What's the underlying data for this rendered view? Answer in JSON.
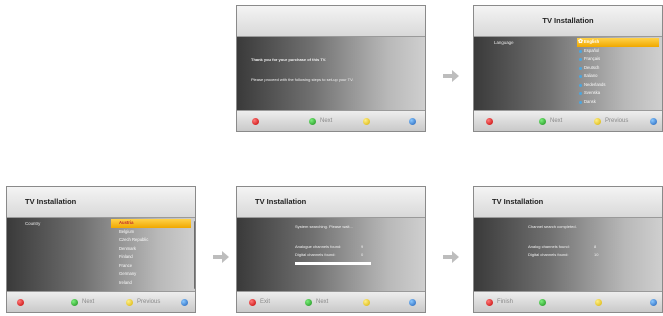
{
  "screen1": {
    "line1": "Thank you for your purchase of this TV.",
    "line2": "Please proceed with the following steps to set-up your TV.",
    "footer": {
      "next": "Next"
    }
  },
  "screen2": {
    "title": "TV Installation",
    "label": "Language",
    "options": [
      "English",
      "Español",
      "Français",
      "Deutsch",
      "Italiano",
      "Nederlands",
      "Svenska",
      "Dansk"
    ],
    "selected": "English",
    "footer": {
      "next": "Next",
      "previous": "Previous"
    }
  },
  "screen3": {
    "title": "TV Installation",
    "label": "Country",
    "options": [
      "Austria",
      "Belgium",
      "Czech Republic",
      "Denmark",
      "Finland",
      "France",
      "Germany",
      "Ireland"
    ],
    "selected": "Austria",
    "footer": {
      "next": "Next",
      "previous": "Previous"
    }
  },
  "screen4": {
    "title": "TV Installation",
    "status": "System searching.  Please wait...",
    "analogue_label": "Analogue channels found:",
    "analogue_value": "9",
    "digital_label": "Digital channels found:",
    "digital_value": "0",
    "progress": 1.0,
    "footer": {
      "exit": "Exit",
      "next": "Next"
    }
  },
  "screen5": {
    "title": "TV Installation",
    "status": "Channel search completed.",
    "analog_label": "Analog channels found:",
    "analog_value": "8",
    "digital_label": "Digital channels found:",
    "digital_value": "10",
    "footer": {
      "finish": "Finish"
    }
  },
  "colors": {
    "header_bg": "#e6e6e6",
    "highlight": "#f5b800",
    "button_red": "#c40000",
    "button_green": "#1a8c1a",
    "button_yellow": "#d8b000",
    "button_blue": "#1e5fb8",
    "arrow": "#bdbdbd"
  },
  "icons": {
    "flow_arrow": "arrow-right-icon",
    "language_option": "globe-dot-icon",
    "selected_language": "gear-icon"
  }
}
